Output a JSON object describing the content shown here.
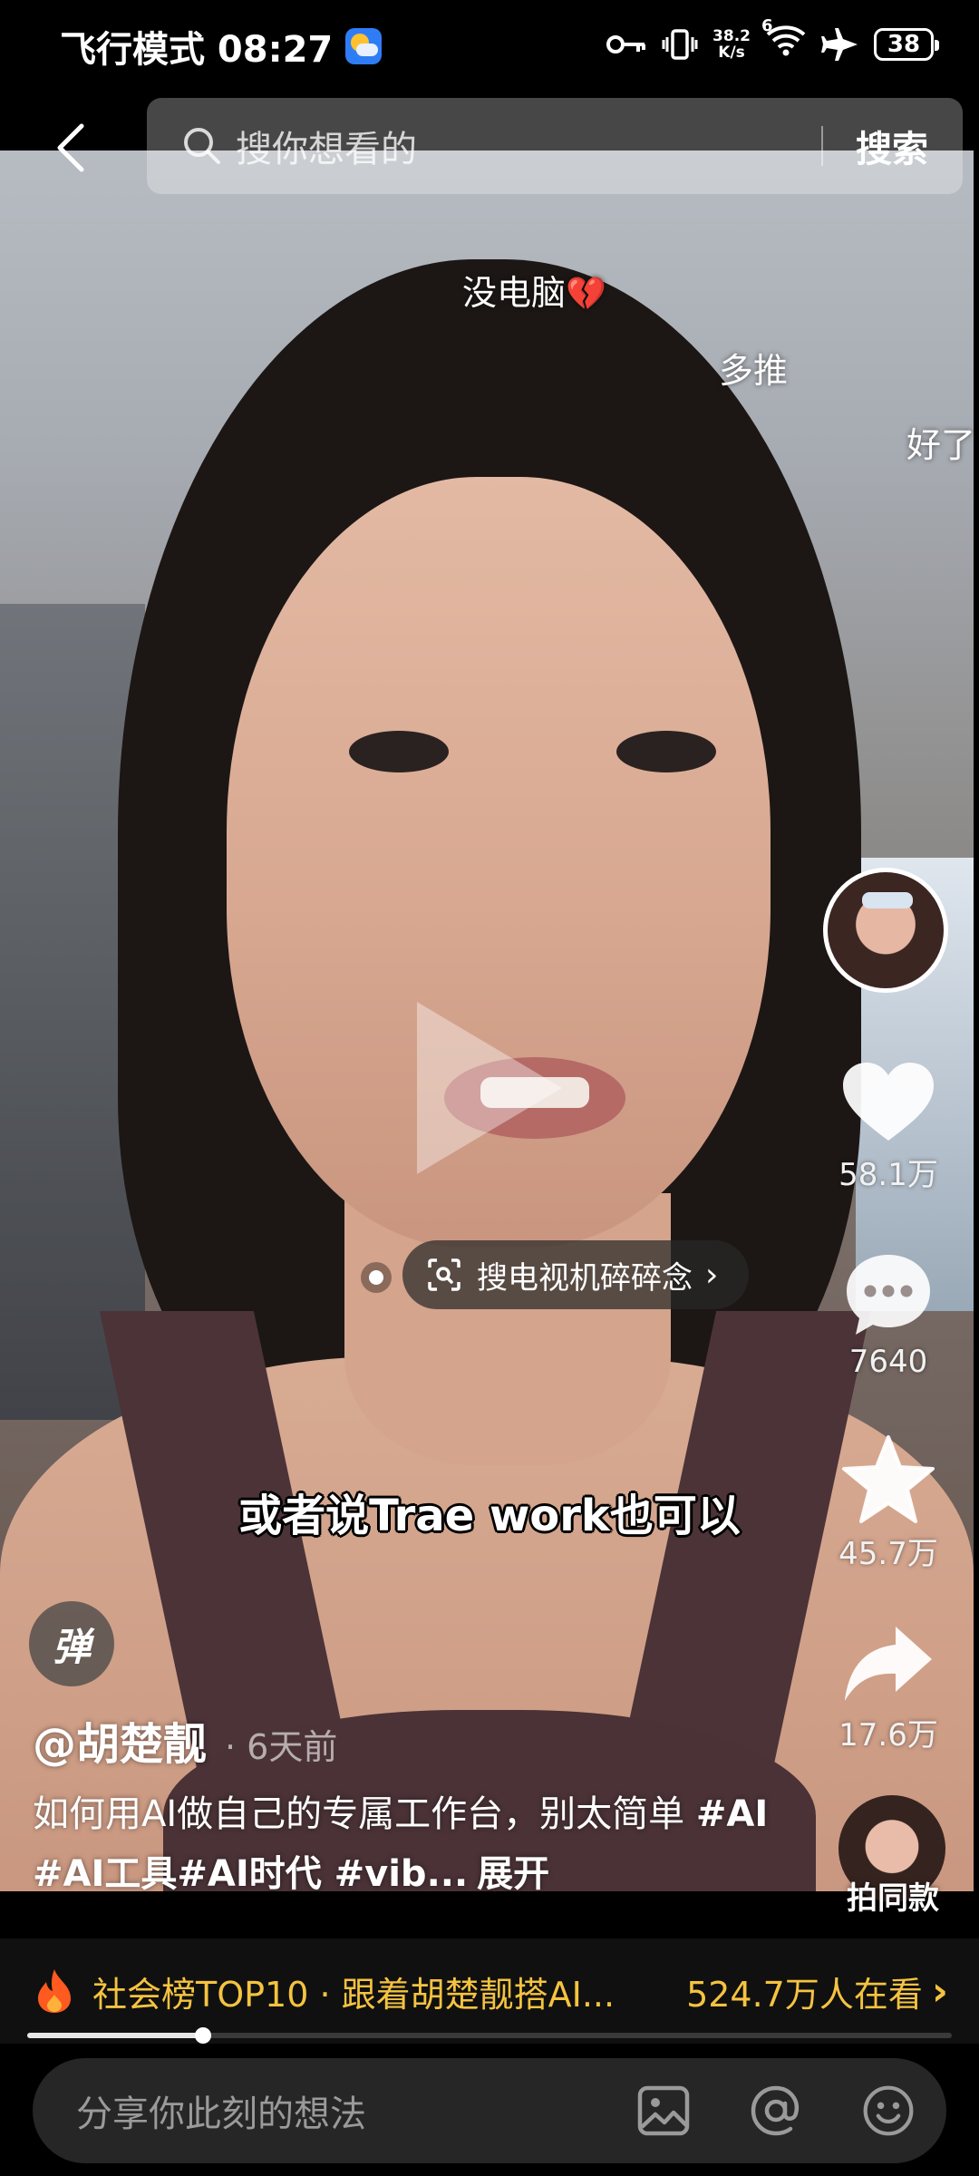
{
  "status_bar": {
    "mode_time": "飞行模式 08:27",
    "net_speed_value": "38.2",
    "net_speed_unit": "K/s",
    "signal_label": "6",
    "battery": "38"
  },
  "search": {
    "placeholder": "搜你想看的",
    "button_label": "搜索"
  },
  "danmaku": [
    "没电脑",
    "多推",
    "好了"
  ],
  "actions": {
    "likes": "58.1万",
    "comments": "7640",
    "favorites": "45.7万",
    "shares": "17.6万",
    "remix_label": "拍同款"
  },
  "search_tag": {
    "label": "搜电视机碎碎念"
  },
  "subtitle": "或者说Trae work也可以",
  "danmaku_toggle": "弹",
  "author": {
    "name": "@胡楚靓",
    "time": "· 6天前"
  },
  "caption": {
    "text": "如何用AI做自己的专属工作台，别太简单 ",
    "tags": "#AI #AI工具#AI时代 #vib...",
    "expand": "展开"
  },
  "hot_banner": {
    "title": "社会榜TOP10 · 跟着胡楚靓搭AI...",
    "viewers": "524.7万人在看"
  },
  "progress": {
    "fraction": 0.19
  },
  "comment": {
    "placeholder": "分享你此刻的想法"
  },
  "colors": {
    "hot_text": "#f5c340",
    "fire": "#ff5a1f"
  }
}
